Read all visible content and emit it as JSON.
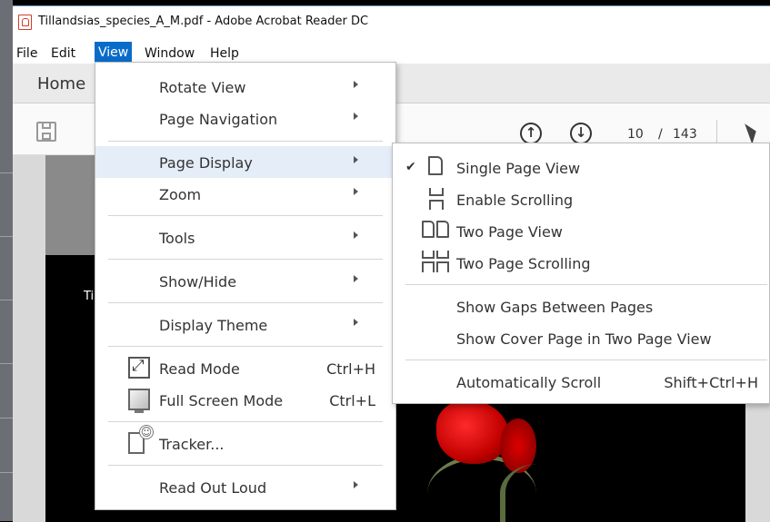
{
  "window": {
    "title": "Tillandsias_species_A_M.pdf - Adobe Acrobat Reader DC"
  },
  "menubar": {
    "items": [
      "File",
      "Edit",
      "View",
      "Window",
      "Help"
    ],
    "active": "View"
  },
  "tabs": {
    "home": "Home"
  },
  "toolbar": {
    "current_page": "10",
    "separator": "/",
    "total_pages": "143"
  },
  "document": {
    "visible_text": "Ti"
  },
  "view_menu": {
    "items": [
      {
        "label": "Rotate View",
        "submenu": true
      },
      {
        "label": "Page Navigation",
        "submenu": true
      },
      {
        "label": "Page Display",
        "submenu": true,
        "highlighted": true
      },
      {
        "label": "Zoom",
        "submenu": true
      },
      {
        "label": "Tools",
        "submenu": true
      },
      {
        "label": "Show/Hide",
        "submenu": true
      },
      {
        "label": "Display Theme",
        "submenu": true
      },
      {
        "label": "Read Mode",
        "shortcut": "Ctrl+H",
        "icon": "read-mode-icon"
      },
      {
        "label": "Full Screen Mode",
        "shortcut": "Ctrl+L",
        "icon": "full-screen-icon"
      },
      {
        "label": "Tracker...",
        "icon": "tracker-icon"
      },
      {
        "label": "Read Out Loud",
        "submenu": true
      }
    ]
  },
  "page_display_submenu": {
    "items": [
      {
        "label": "Single Page View",
        "checked": true,
        "icon": "single-page-icon"
      },
      {
        "label": "Enable Scrolling",
        "icon": "scrolling-icon"
      },
      {
        "label": "Two Page View",
        "icon": "two-page-icon"
      },
      {
        "label": "Two Page Scrolling",
        "icon": "two-page-scrolling-icon"
      },
      {
        "label": "Show Gaps Between Pages"
      },
      {
        "label": "Show Cover Page in Two Page View"
      },
      {
        "label": "Automatically Scroll",
        "shortcut": "Shift+Ctrl+H"
      }
    ],
    "check_glyph": "✔"
  }
}
